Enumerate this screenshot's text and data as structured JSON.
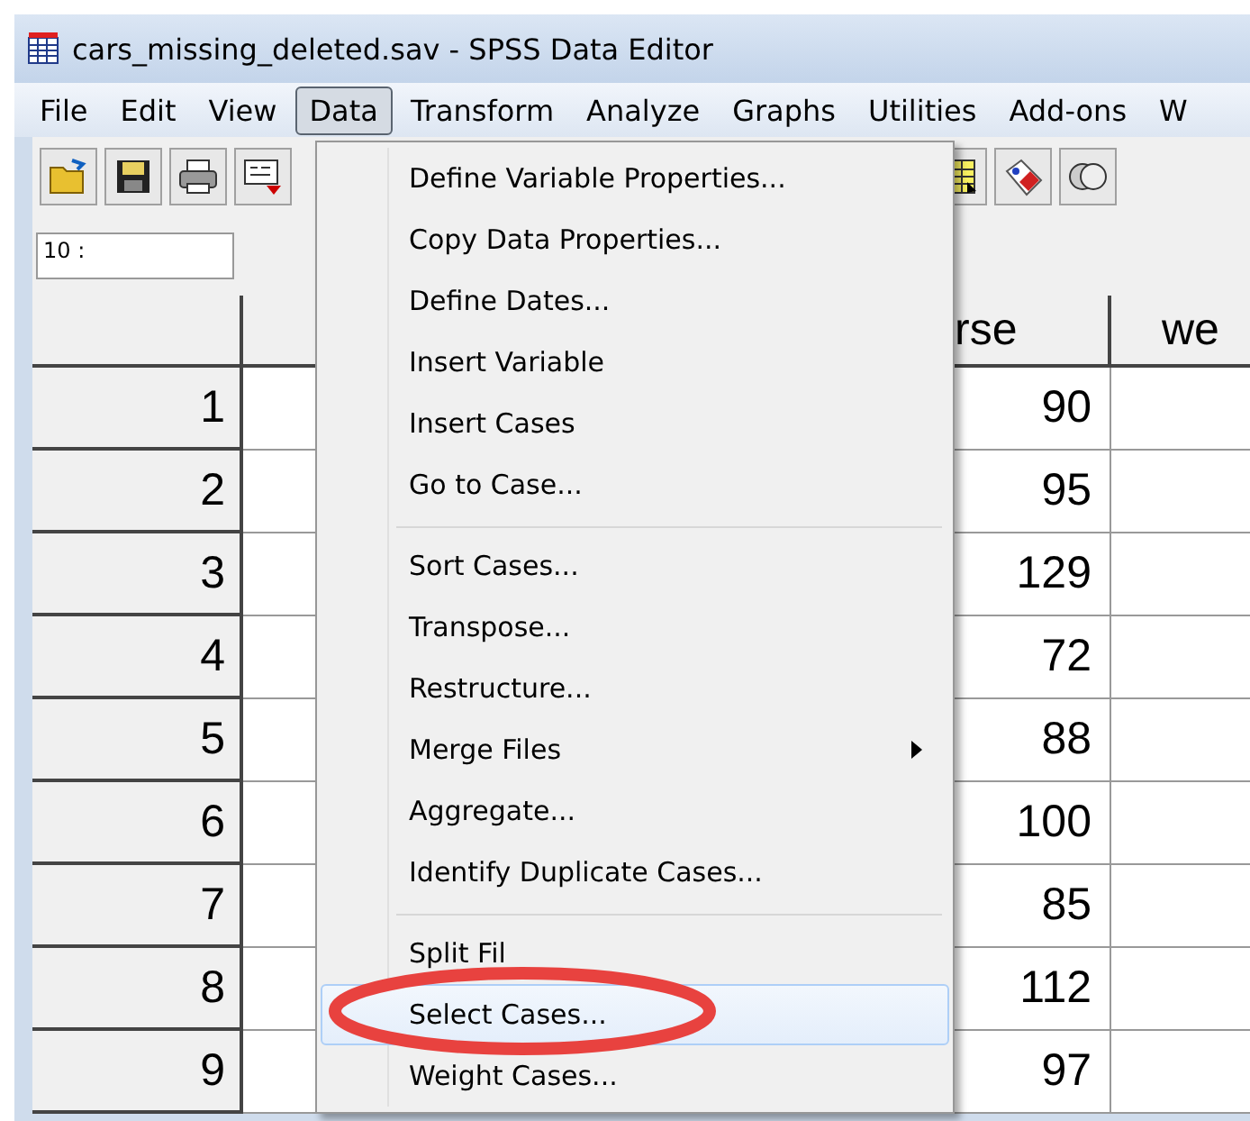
{
  "window": {
    "title": "cars_missing_deleted.sav - SPSS Data Editor"
  },
  "menu_bar": [
    {
      "label": "File",
      "selected": false
    },
    {
      "label": "Edit",
      "selected": false
    },
    {
      "label": "View",
      "selected": false
    },
    {
      "label": "Data",
      "selected": true
    },
    {
      "label": "Transform",
      "selected": false
    },
    {
      "label": "Analyze",
      "selected": false
    },
    {
      "label": "Graphs",
      "selected": false
    },
    {
      "label": "Utilities",
      "selected": false
    },
    {
      "label": "Add-ons",
      "selected": false
    },
    {
      "label": "W",
      "selected": false
    }
  ],
  "cell_reference": "10 :",
  "table": {
    "column_4_header": "rse",
    "column_5_header": "we",
    "rows": [
      {
        "number": "1",
        "column_4": "90"
      },
      {
        "number": "2",
        "column_4": "95"
      },
      {
        "number": "3",
        "column_4": "129"
      },
      {
        "number": "4",
        "column_4": "72"
      },
      {
        "number": "5",
        "column_4": "88"
      },
      {
        "number": "6",
        "column_4": "100"
      },
      {
        "number": "7",
        "column_4": "85"
      },
      {
        "number": "8",
        "column_4": "112"
      },
      {
        "number": "9",
        "column_4": "97"
      }
    ]
  },
  "data_menu": {
    "items": [
      {
        "kind": "item",
        "label": "Define Variable Properties...",
        "selected": false,
        "submenu": false
      },
      {
        "kind": "item",
        "label": "Copy Data Properties...",
        "selected": false,
        "submenu": false
      },
      {
        "kind": "item",
        "label": "Define Dates...",
        "selected": false,
        "submenu": false
      },
      {
        "kind": "item",
        "label": "Insert Variable",
        "selected": false,
        "submenu": false
      },
      {
        "kind": "item",
        "label": "Insert Cases",
        "selected": false,
        "submenu": false
      },
      {
        "kind": "item",
        "label": "Go to Case...",
        "selected": false,
        "submenu": false
      },
      {
        "kind": "separator"
      },
      {
        "kind": "item",
        "label": "Sort Cases...",
        "selected": false,
        "submenu": false
      },
      {
        "kind": "item",
        "label": "Transpose...",
        "selected": false,
        "submenu": false
      },
      {
        "kind": "item",
        "label": "Restructure...",
        "selected": false,
        "submenu": false
      },
      {
        "kind": "item",
        "label": "Merge Files",
        "selected": false,
        "submenu": true
      },
      {
        "kind": "item",
        "label": "Aggregate...",
        "selected": false,
        "submenu": false
      },
      {
        "kind": "item",
        "label": "Identify Duplicate Cases...",
        "selected": false,
        "submenu": false
      },
      {
        "kind": "separator"
      },
      {
        "kind": "item",
        "label": "Split Fil",
        "selected": false,
        "submenu": false
      },
      {
        "kind": "item",
        "label": "Select Cases...",
        "selected": true,
        "submenu": false
      },
      {
        "kind": "item",
        "label": "Weight Cases...",
        "selected": false,
        "submenu": false
      }
    ]
  }
}
